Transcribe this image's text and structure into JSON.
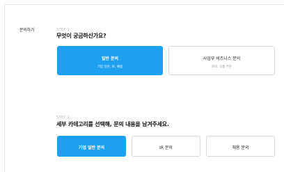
{
  "sidebar": {
    "label": "문의하기"
  },
  "step1": {
    "label": "STEP 1",
    "title": "무엇이 궁금하신가요?",
    "options": [
      {
        "title": "일반 문의",
        "subtitle": "기업 일반, IR, 채용",
        "active": true
      },
      {
        "title": "사업부 비즈니스 문의",
        "subtitle": "화학, 식품 부문",
        "active": false
      }
    ]
  },
  "step2": {
    "label": "STEP 2",
    "title": "세부 카테고리를 선택해, 문의 내용을 남겨주세요.",
    "options": [
      {
        "title": "기업 일반 문의",
        "active": true
      },
      {
        "title": "IR 문의",
        "active": false
      },
      {
        "title": "채용 문의",
        "active": false
      }
    ]
  },
  "colors": {
    "accent": "#1ea0f0",
    "border": "#d9d9d9",
    "step_label": "#b8b8b8"
  }
}
